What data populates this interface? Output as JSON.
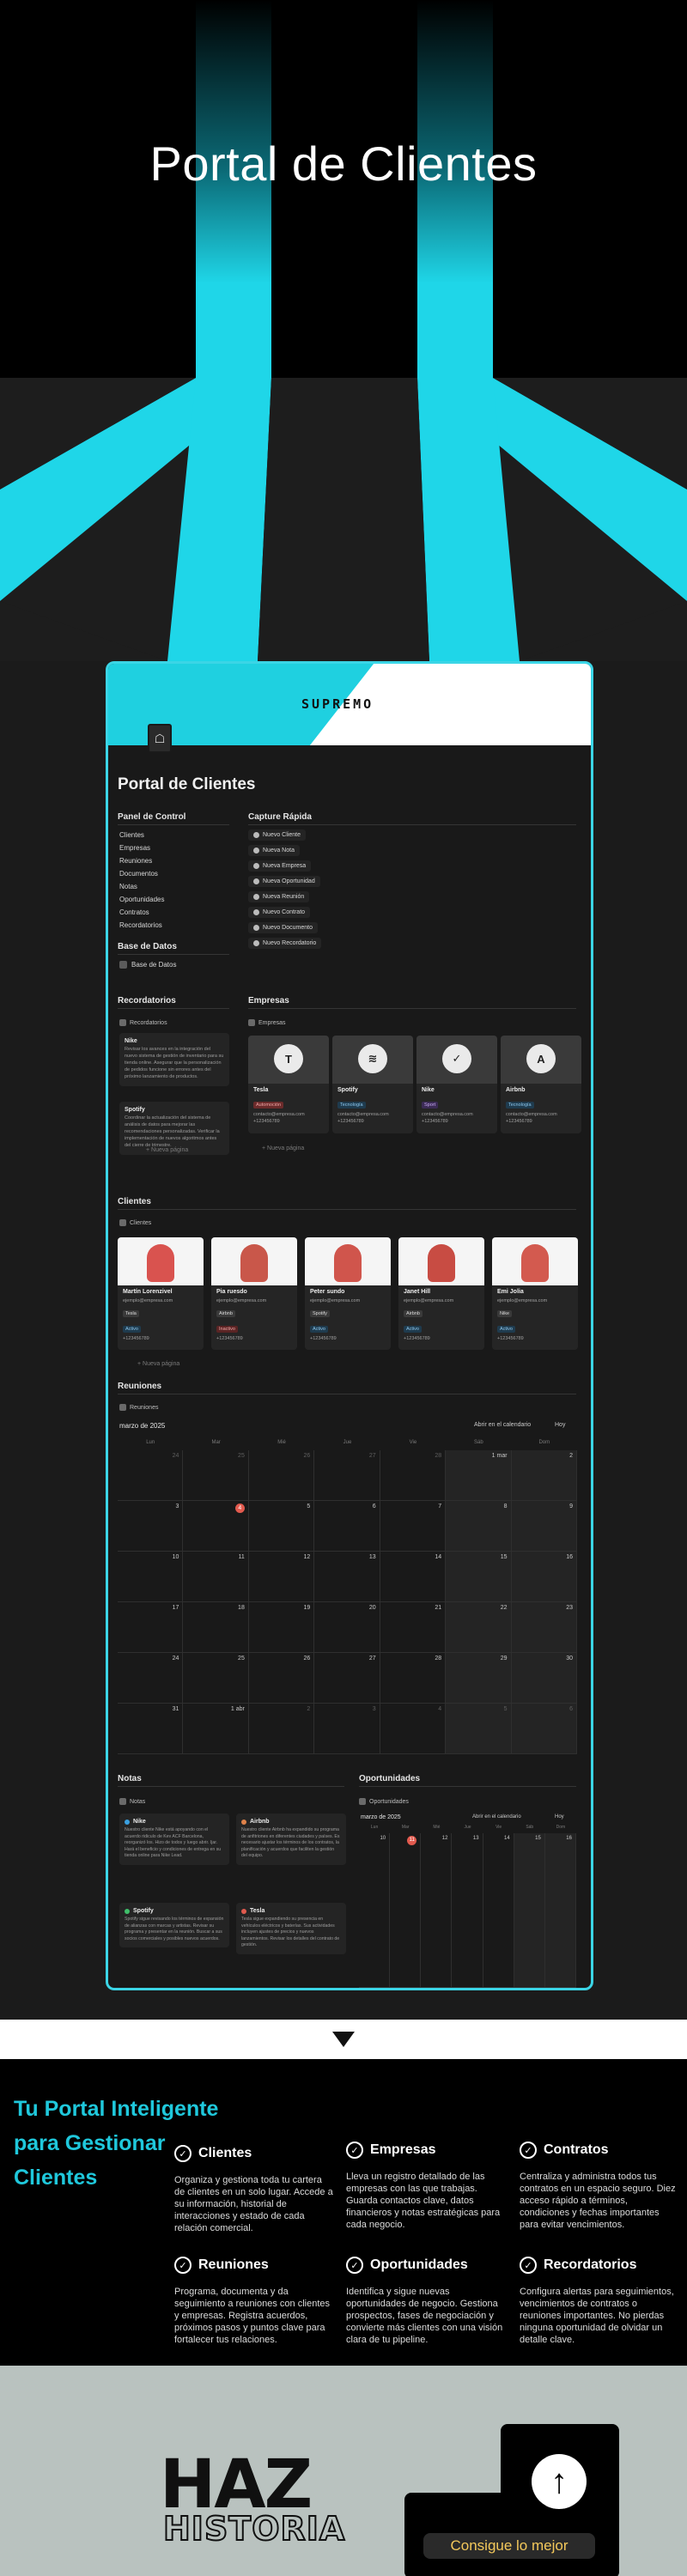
{
  "hero": {
    "title": "Portal de Clientes"
  },
  "app": {
    "logo_text": "SUPREMO",
    "page_title": "Portal de Clientes",
    "panel": {
      "title": "Panel de Control",
      "items": [
        "Clientes",
        "Empresas",
        "Reuniones",
        "Documentos",
        "Notas",
        "Oportunidades",
        "Contratos",
        "Recordatorios"
      ]
    },
    "base_datos": {
      "title": "Base de Datos",
      "item": "Base de Datos"
    },
    "captura": {
      "title": "Capture Rápida",
      "buttons": [
        "Nuevo Cliente",
        "Nueva Nota",
        "Nueva Empresa",
        "Nueva Oportunidad",
        "Nueva Reunión",
        "Nuevo Contrato",
        "Nuevo Documento",
        "Nuevo Recordatorio"
      ]
    },
    "recordatorios": {
      "title": "Recordatorios",
      "db": "Recordatorios",
      "cards": [
        {
          "title": "Nike",
          "text": "Revisar los avances en la integración del nuevo sistema de gestión de inventario para su tienda online. Asegurar que la personalización de pedidos funcione sin errores antes del próximo lanzamiento de productos."
        },
        {
          "title": "Spotify",
          "text": "Coordinar la actualización del sistema de análisis de datos para mejorar las recomendaciones personalizadas. Verificar la implementación de nuevos algoritmos antes del cierre de trimestre."
        }
      ],
      "new_page": "+ Nueva página"
    },
    "empresas": {
      "title": "Empresas",
      "db": "Empresas",
      "cards": [
        {
          "name": "Tesla",
          "tag": "Automoción",
          "email": "contacto@empresa.com",
          "phone": "+123456789",
          "logo": "T",
          "tag_color": "#6b2b2b",
          "tag_text_color": "#f1a6a6"
        },
        {
          "name": "Spotify",
          "tag": "Tecnología",
          "email": "contacto@empresa.com",
          "phone": "+123456789",
          "logo": "≋",
          "tag_color": "#1f3b4e",
          "tag_text_color": "#8ec9f0"
        },
        {
          "name": "Nike",
          "tag": "Sport",
          "email": "contacto@empresa.com",
          "phone": "+123456789",
          "logo": "✓",
          "tag_color": "#3b2b55",
          "tag_text_color": "#c7a9f2"
        },
        {
          "name": "Airbnb",
          "tag": "Tecnología",
          "email": "contacto@empresa.com",
          "phone": "+123456789",
          "logo": "A",
          "tag_color": "#1f3b4e",
          "tag_text_color": "#8ec9f0"
        }
      ],
      "new_page": "+ Nueva página"
    },
    "clientes": {
      "title": "Clientes",
      "db": "Clientes",
      "cards": [
        {
          "name": "Martín Lorenzivel",
          "email": "ejemplo@empresa.com",
          "company": "Tesla",
          "status": "Activo",
          "phone": "+123456789",
          "skin": "#d9534f"
        },
        {
          "name": "Pia ruesdo",
          "email": "ejemplo@empresa.com",
          "company": "Airbnb",
          "status": "Inactivo",
          "phone": "+123456789",
          "skin": "#c9574a"
        },
        {
          "name": "Peter sundo",
          "email": "ejemplo@empresa.com",
          "company": "Spotify",
          "status": "Activo",
          "phone": "+123456789",
          "skin": "#d0554c"
        },
        {
          "name": "Janet Hill",
          "email": "ejemplo@empresa.com",
          "company": "Airbnb",
          "status": "Activo",
          "phone": "+123456789",
          "skin": "#c84c43"
        },
        {
          "name": "Emi Jolia",
          "email": "ejemplo@empresa.com",
          "company": "Nike",
          "status": "Activo",
          "phone": "+123456789",
          "skin": "#d35a4f"
        }
      ],
      "new_page": "+ Nueva página"
    },
    "reuniones": {
      "title": "Reuniones",
      "db": "Reuniones",
      "month": "marzo de 2025",
      "open_calendar": "Abrir en el calendario",
      "today": "Hoy",
      "dow": [
        "Lun",
        "Mar",
        "Mié",
        "Jue",
        "Vie",
        "Sáb",
        "Dom"
      ],
      "cells": [
        "24",
        "25",
        "26",
        "27",
        "28",
        "1 mar",
        "2",
        "3",
        "4",
        "5",
        "6",
        "7",
        "8",
        "9",
        "10",
        "11",
        "12",
        "13",
        "14",
        "15",
        "16",
        "17",
        "18",
        "19",
        "20",
        "21",
        "22",
        "23",
        "24",
        "25",
        "26",
        "27",
        "28",
        "29",
        "30",
        "31",
        "1 abr",
        "2",
        "3",
        "4",
        "5",
        "6"
      ],
      "today_index": 8
    },
    "notas": {
      "title": "Notas",
      "db": "Notas",
      "cards": [
        {
          "title": "Nike",
          "color": "#3aa0e0",
          "text": "Nuestro cliente Nike está apoyando con el acuerdo ridiculo de Kev ACF Barcelona, reorganizó los. Hizo de todos y luego abrir. Ijar. Hará el beneficio y condiciones de entrega en su tienda online para Nike Lead."
        },
        {
          "title": "Airbnb",
          "color": "#e0824a",
          "text": "Nuestro cliente Airbnb ha expandido su programa de anfitriones en diferentes ciudades y países. Es necesario ajustar los términos de los contratos, la planificación y acuerdos que faciliten la gestión del equipo."
        },
        {
          "title": "Spotify",
          "color": "#3fbf6a",
          "text": "Spotify sigue revisando los términos de expansión de alianzas con marcas y artistas. Revisar su programa y presentar en la reunión. Buscar a sus socios comerciales y posibles nuevos acuerdos."
        },
        {
          "title": "Tesla",
          "color": "#e05a4e",
          "text": "Tesla sigue expandiendo su presencia en vehículos eléctricos y baterías. Sus actividades incluyen ajustes de precios y nuevos lanzamientos. Revisar los detalles del contrato de gestión."
        }
      ]
    },
    "oportunidades": {
      "title": "Oportunidades",
      "db": "Oportunidades",
      "month": "marzo de 2025",
      "open_calendar": "Abrir en el calendario",
      "today": "Hoy",
      "dow": [
        "Lun",
        "Mar",
        "Mié",
        "Jue",
        "Vie",
        "Sáb",
        "Dom"
      ],
      "cells": [
        "10",
        "11",
        "12",
        "13",
        "14",
        "15",
        "16"
      ],
      "today_index": 1
    }
  },
  "features": {
    "title": "Tu Portal Inteligente para Gestionar Clientes",
    "items": [
      {
        "title": "Clientes",
        "desc": "Organiza y gestiona toda tu cartera de clientes en un solo lugar. Accede a su información, historial de interacciones y estado de cada relación comercial."
      },
      {
        "title": "Empresas",
        "desc": "Lleva un registro detallado de las empresas con las que trabajas. Guarda contactos clave, datos financieros y notas estratégicas para cada negocio."
      },
      {
        "title": "Contratos",
        "desc": "Centraliza y administra todos tus contratos en un espacio seguro. Diez acceso rápido a términos, condiciones y fechas importantes para evitar vencimientos."
      },
      {
        "title": "Reuniones",
        "desc": "Programa, documenta y da seguimiento a reuniones con clientes y empresas. Registra acuerdos, próximos pasos y puntos clave para fortalecer tus relaciones."
      },
      {
        "title": "Oportunidades",
        "desc": "Identifica y sigue nuevas oportunidades de negocio. Gestiona prospectos, fases de negociación y convierte más clientes con una visión clara de tu pipeline."
      },
      {
        "title": "Recordatorios",
        "desc": "Configura alertas para seguimientos, vencimientos de contratos o reuniones importantes. No pierdas ninguna oportunidad de olvidar un detalle clave."
      }
    ]
  },
  "footer": {
    "haz": "HAZ",
    "historia": "HISTORIA",
    "cta": "Consigue lo mejor"
  },
  "colors": {
    "accent": "#1fd0e0",
    "background": "#1b1b1b",
    "cta_text": "#f3c85b"
  }
}
